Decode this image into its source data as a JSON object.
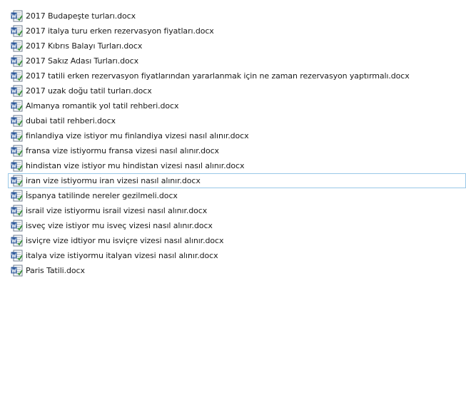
{
  "files": [
    {
      "name": "2017 Budapeşte turları.docx",
      "icon": "word-document-icon"
    },
    {
      "name": "2017 italya turu erken rezervasyon fiyatları.docx",
      "icon": "word-document-icon"
    },
    {
      "name": "2017 Kıbrıs Balayı Turları.docx",
      "icon": "word-document-icon"
    },
    {
      "name": "2017 Sakız Adası Turları.docx",
      "icon": "word-document-icon"
    },
    {
      "name": "2017 tatili erken rezervasyon fiyatlarından yararlanmak için ne zaman rezervasyon yaptırmalı.docx",
      "icon": "word-document-icon"
    },
    {
      "name": "2017 uzak doğu tatil turları.docx",
      "icon": "word-document-icon"
    },
    {
      "name": "Almanya romantik yol tatil rehberi.docx",
      "icon": "word-document-icon"
    },
    {
      "name": "dubai tatil rehberi.docx",
      "icon": "word-document-icon"
    },
    {
      "name": "finlandiya vize istiyor mu finlandiya vizesi nasıl alınır.docx",
      "icon": "word-document-icon"
    },
    {
      "name": "fransa vize istiyormu fransa vizesi nasıl alınır.docx",
      "icon": "word-document-icon"
    },
    {
      "name": "hindistan vize istiyor mu hindistan vizesi nasıl alınır.docx",
      "icon": "word-document-icon"
    },
    {
      "name": "iran vize istiyormu iran vizesi nasıl alınır.docx",
      "icon": "word-document-icon"
    },
    {
      "name": "İspanya tatilinde nereler gezilmeli.docx",
      "icon": "word-document-icon"
    },
    {
      "name": "israil vize istiyormu israil vizesi nasıl alınır.docx",
      "icon": "word-document-icon"
    },
    {
      "name": "isveç vize istiyor mu isveç vizesi nasıl alınır.docx",
      "icon": "word-document-icon"
    },
    {
      "name": "isviçre vize idtiyor mu isviçre vizesi nasıl alınır.docx",
      "icon": "word-document-icon"
    },
    {
      "name": "italya vize istiyormu italyan vizesi nasıl alınır.docx",
      "icon": "word-document-icon"
    },
    {
      "name": "Paris Tatili.docx",
      "icon": "word-document-icon"
    }
  ],
  "focused_index": 11,
  "colors": {
    "focus_border": "#99c8e8",
    "icon_blue": "#2b579a",
    "icon_green": "#3a8f3a"
  }
}
